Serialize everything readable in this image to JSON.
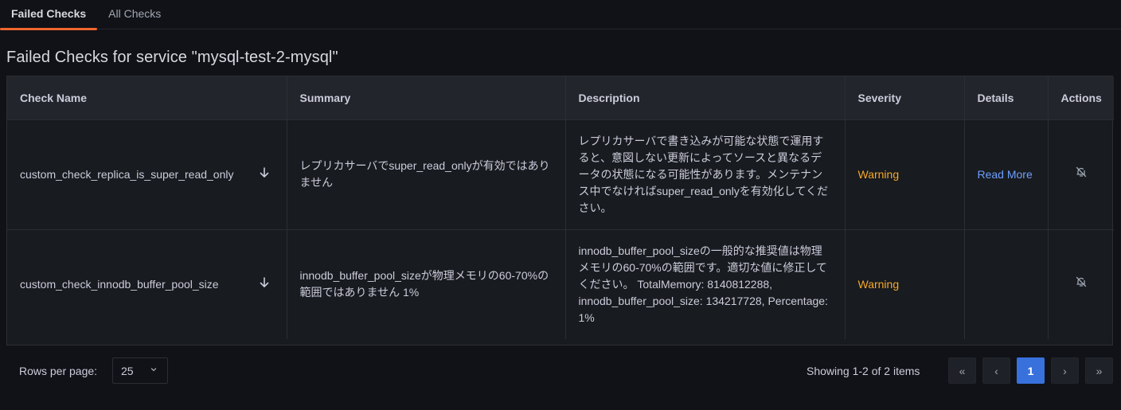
{
  "tabs": [
    {
      "label": "Failed Checks",
      "active": true
    },
    {
      "label": "All Checks",
      "active": false
    }
  ],
  "page_title": "Failed Checks for service \"mysql-test-2-mysql\"",
  "table": {
    "headers": {
      "check_name": "Check Name",
      "summary": "Summary",
      "description": "Description",
      "severity": "Severity",
      "details": "Details",
      "actions": "Actions"
    },
    "rows": [
      {
        "check_name": "custom_check_replica_is_super_read_only",
        "summary": "レプリカサーバでsuper_read_onlyが有効ではありません",
        "description": "レプリカサーバで書き込みが可能な状態で運用すると、意図しない更新によってソースと異なるデータの状態になる可能性があります。メンテナンス中でなければsuper_read_onlyを有効化してください。",
        "severity": "Warning",
        "details": "Read More"
      },
      {
        "check_name": "custom_check_innodb_buffer_pool_size",
        "summary": "innodb_buffer_pool_sizeが物理メモリの60-70%の範囲ではありません 1%",
        "description": "innodb_buffer_pool_sizeの一般的な推奨値は物理メモリの60-70%の範囲です。適切な値に修正してください。 TotalMemory: 8140812288, innodb_buffer_pool_size: 134217728, Percentage: 1%",
        "severity": "Warning",
        "details": ""
      }
    ]
  },
  "colors": {
    "warning": "#f8a82b",
    "link": "#6e9fff",
    "accent": "#3871dc",
    "tab_indicator": "#f0662b"
  },
  "footer": {
    "rows_per_page_label": "Rows per page:",
    "rows_per_page_value": "25",
    "showing": "Showing 1-2 of 2 items",
    "pagination": {
      "first": "«",
      "prev": "‹",
      "current": "1",
      "next": "›",
      "last": "»"
    }
  },
  "icons": {
    "sort": "arrow-down-icon",
    "mute": "bell-slash-icon",
    "select": "chevron-down-icon"
  }
}
